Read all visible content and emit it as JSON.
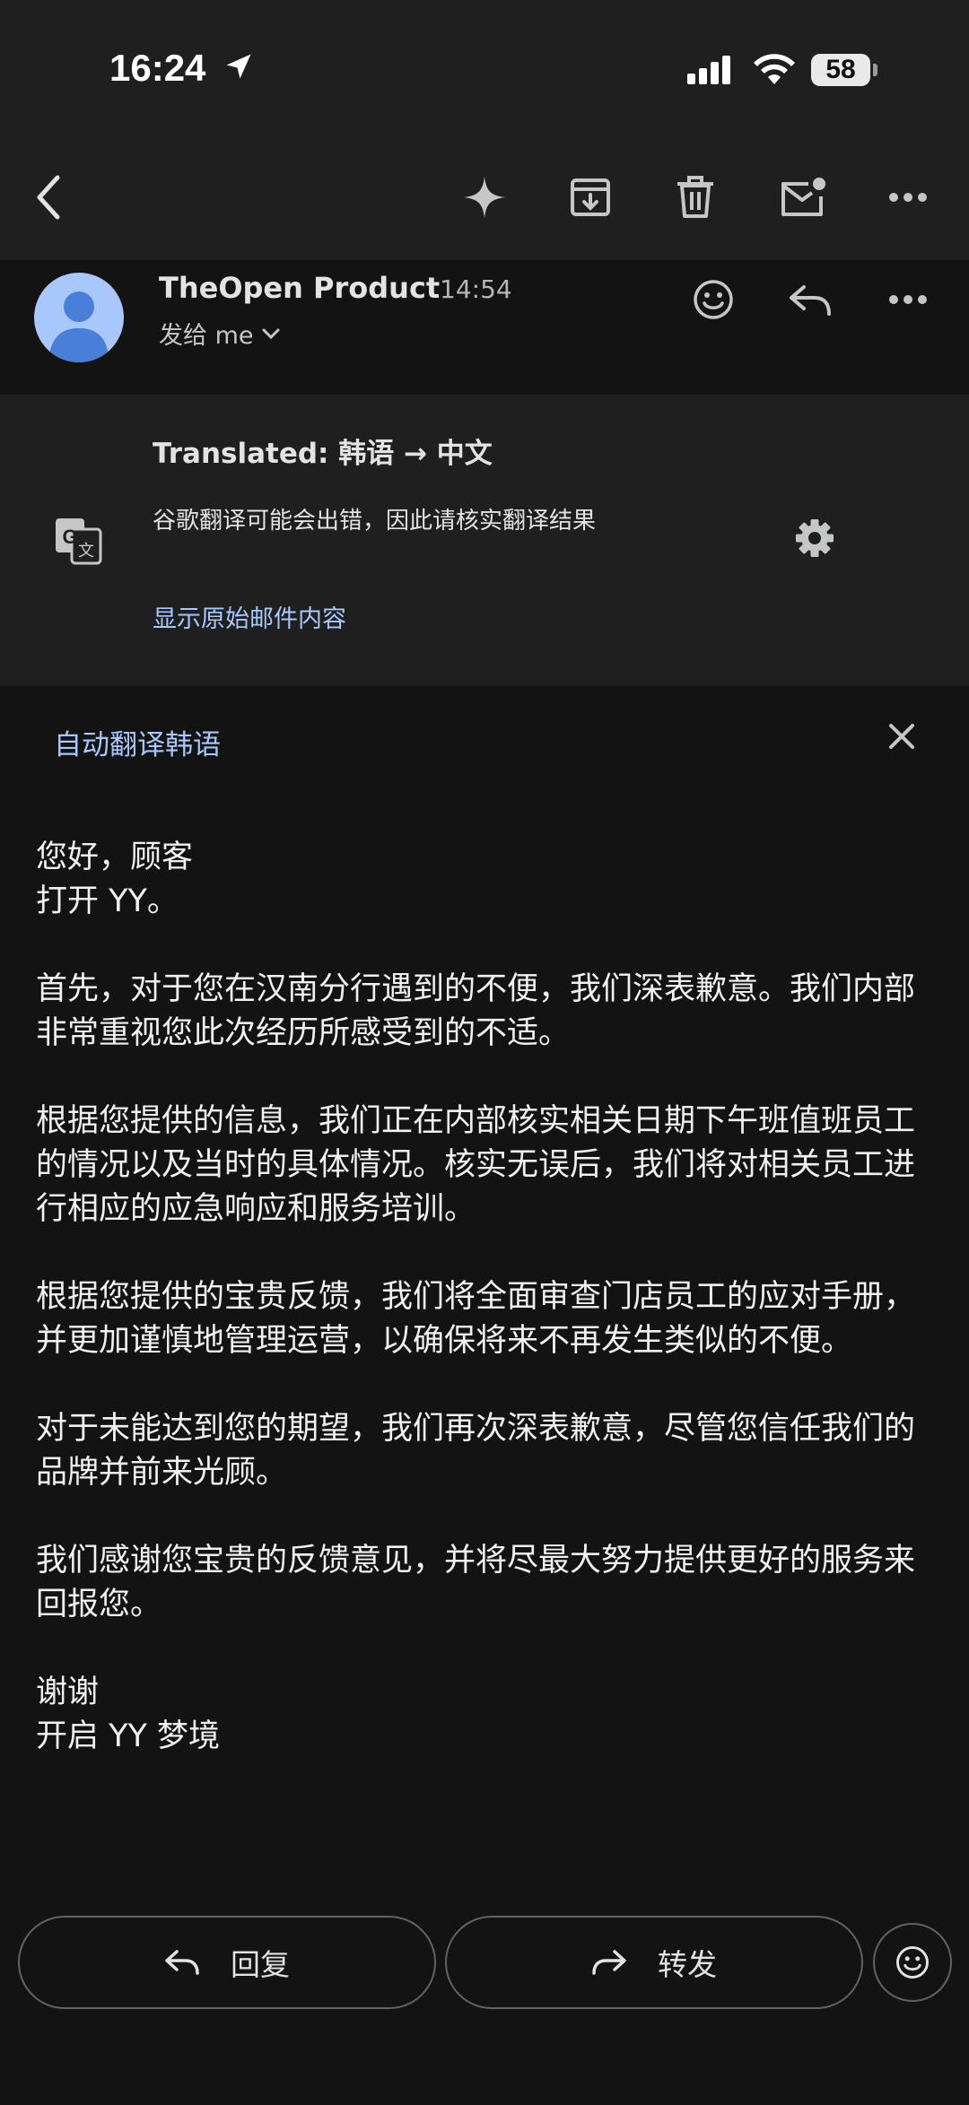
{
  "status_bar": {
    "time": "16:24",
    "battery": "58"
  },
  "toolbar": {
    "icons": [
      "back-icon",
      "sparkle-icon",
      "archive-icon",
      "delete-icon",
      "mark-unread-icon",
      "more-icon"
    ]
  },
  "sender": {
    "name": "TheOpen Product",
    "time": "14:54",
    "to_line": "发给 me"
  },
  "translation": {
    "title": "Translated: 韩语 → 中文",
    "note": "谷歌翻译可能会出错，因此请核实翻译结果",
    "show_original": "显示原始邮件内容"
  },
  "auto_translate": {
    "label": "自动翻译韩语"
  },
  "body": {
    "paragraphs": [
      "您好，顾客\n打开 YY。",
      "首先，对于您在汉南分行遇到的不便，我们深表歉意。我们内部非常重视您此次经历所感受到的不适。",
      "根据您提供的信息，我们正在内部核实相关日期下午班值班员工的情况以及当时的具体情况。核实无误后，我们将对相关员工进行相应的应急响应和服务培训。",
      "根据您提供的宝贵反馈，我们将全面审查门店员工的应对手册，并更加谨慎地管理运营，以确保将来不再发生类似的不便。",
      "对于未能达到您的期望，我们再次深表歉意，尽管您信任我们的品牌并前来光顾。",
      "我们感谢您宝贵的反馈意见，并将尽最大努力提供更好的服务来回报您。",
      "谢谢\n开启 YY 梦境"
    ]
  },
  "actions": {
    "reply": "回复",
    "forward": "转发"
  },
  "colors": {
    "accent_link": "#a8c7fa",
    "background": "#131314",
    "card": "#1f1f1f"
  }
}
